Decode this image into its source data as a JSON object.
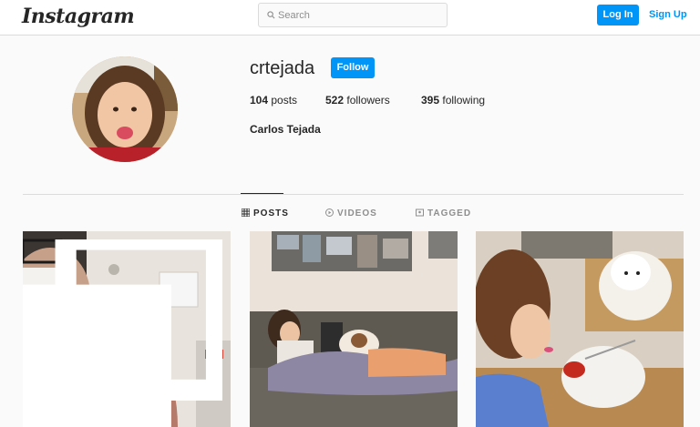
{
  "header": {
    "logo": "Instagram",
    "search_placeholder": "Search",
    "login_label": "Log In",
    "signup_label": "Sign Up"
  },
  "profile": {
    "username": "crtejada",
    "follow_label": "Follow",
    "posts_count": "104",
    "posts_label": "posts",
    "followers_count": "522",
    "followers_label": "followers",
    "following_count": "395",
    "following_label": "following",
    "full_name": "Carlos Tejada"
  },
  "tabs": [
    {
      "label": "POSTS",
      "icon": "grid-icon",
      "active": true
    },
    {
      "label": "VIDEOS",
      "icon": "play-icon",
      "active": false
    },
    {
      "label": "TAGGED",
      "icon": "tag-icon",
      "active": false
    }
  ],
  "posts": [
    {
      "subject": "man-with-mask",
      "multiple": true
    },
    {
      "subject": "girl-on-couch-with-dog",
      "multiple": false
    },
    {
      "subject": "girl-eating-with-plush",
      "multiple": false
    }
  ],
  "colors": {
    "accent": "#0095f6",
    "text": "#262626",
    "muted": "#8e8e8e",
    "border": "#dbdbdb",
    "background": "#fafafa"
  }
}
